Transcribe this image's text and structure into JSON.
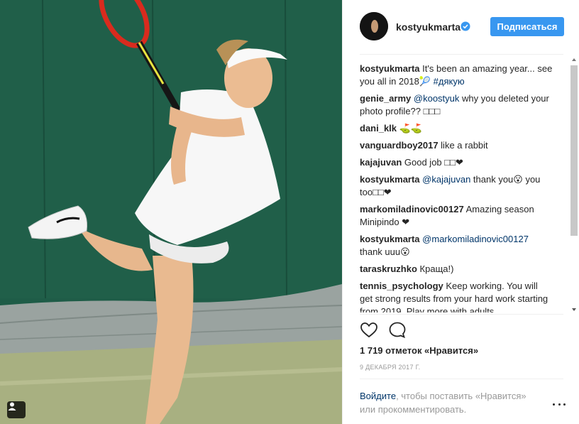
{
  "post": {
    "username": "kostyukmarta",
    "follow_label": "Подписаться",
    "likes_text": "1 719 отметок «Нравится»",
    "date": "9 ДЕКАБРЯ 2017 Г."
  },
  "comments": [
    {
      "author": "kostyukmarta",
      "parts": [
        {
          "type": "text",
          "value": "It's been an amazing year... see you all in 2018🎾 "
        },
        {
          "type": "hashtag",
          "value": "#дякую"
        }
      ]
    },
    {
      "author": "genie_army",
      "parts": [
        {
          "type": "mention",
          "value": "@koostyuk"
        },
        {
          "type": "text",
          "value": " why you deleted your photo profile?? □□□"
        }
      ]
    },
    {
      "author": "dani_klk",
      "parts": [
        {
          "type": "text",
          "value": "⛳⛳"
        }
      ]
    },
    {
      "author": "vanguardboy2017",
      "parts": [
        {
          "type": "text",
          "value": "like a rabbit"
        }
      ]
    },
    {
      "author": "kajajuvan",
      "parts": [
        {
          "type": "text",
          "value": "Good job □□❤"
        }
      ]
    },
    {
      "author": "kostyukmarta",
      "parts": [
        {
          "type": "mention",
          "value": "@kajajuvan"
        },
        {
          "type": "text",
          "value": " thank you😮 you too□□❤"
        }
      ]
    },
    {
      "author": "markomiladinovic00127",
      "parts": [
        {
          "type": "text",
          "value": "Amazing season Minipindo ❤"
        }
      ]
    },
    {
      "author": "kostyukmarta",
      "parts": [
        {
          "type": "mention",
          "value": "@markomiladinovic00127"
        },
        {
          "type": "text",
          "value": " thank uuu😮"
        }
      ]
    },
    {
      "author": "taraskruzhko",
      "parts": [
        {
          "type": "text",
          "value": "Краща!)"
        }
      ]
    },
    {
      "author": "tennis_psychology",
      "parts": [
        {
          "type": "text",
          "value": "Keep working. You will get strong results from your hard work starting from 2019. Play more with adults"
        }
      ]
    }
  ],
  "login": {
    "link_text": "Войдите",
    "rest_text": ", чтобы поставить «Нравится» или прокомментировать."
  },
  "icons": {
    "verified": "verified-badge-icon",
    "like": "heart-icon",
    "comment": "speech-bubble-icon",
    "more": "more-options-icon",
    "tag": "person-tag-icon"
  },
  "colors": {
    "accent": "#3897f0",
    "link": "#003569",
    "muted": "#999999",
    "text": "#262626"
  }
}
